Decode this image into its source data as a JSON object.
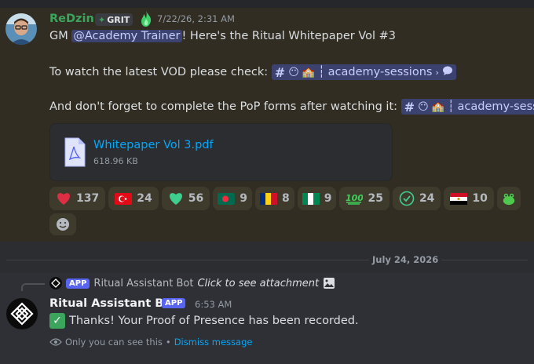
{
  "message1": {
    "username": "ReDzin",
    "tag": "GRIT",
    "timestamp": "7/22/26, 2:31 AM",
    "line1_prefix": "GM ",
    "mention": "@Academy Trainer",
    "line1_suffix": "! Here's the Ritual Whitepaper Vol #3",
    "line2_text": "To watch the latest VOD please check:",
    "line2_channel": "academy-sessions",
    "line3_text": "And don't forget to complete the PoP forms after watching it:",
    "line3_channel": "academy-session",
    "attachment": {
      "name": "Whitepaper Vol 3.pdf",
      "size": "618.96 KB"
    },
    "reactions": [
      {
        "icon": "red-heart",
        "count": "137"
      },
      {
        "icon": "flag-turkey",
        "count": "24"
      },
      {
        "icon": "green-heart",
        "count": "56"
      },
      {
        "icon": "flag-bangladesh",
        "count": "9"
      },
      {
        "icon": "flag-romania",
        "count": "8"
      },
      {
        "icon": "flag-nigeria",
        "count": "9"
      },
      {
        "icon": "hundred-points",
        "count": "25"
      },
      {
        "icon": "check-circle",
        "count": "24"
      },
      {
        "icon": "flag-egypt",
        "count": "10"
      }
    ]
  },
  "date_divider": "July 24, 2026",
  "message2": {
    "reply_app": "APP",
    "reply_name": "Ritual Assistant Bot",
    "reply_text": "Click to see attachment",
    "bot_name": "Ritual Assistant Bot",
    "app_badge": "APP",
    "timestamp": "6:53 AM",
    "text": "Thanks! Your Proof of Presence has been recorded.",
    "ephemeral_text": "Only you can see this",
    "ephemeral_sep": " • ",
    "dismiss": "Dismiss message"
  },
  "colors": {
    "username": "#3ba55d",
    "highlight_bg": "#322d22",
    "link": "#00a8fc",
    "app_badge": "#5865f2"
  }
}
